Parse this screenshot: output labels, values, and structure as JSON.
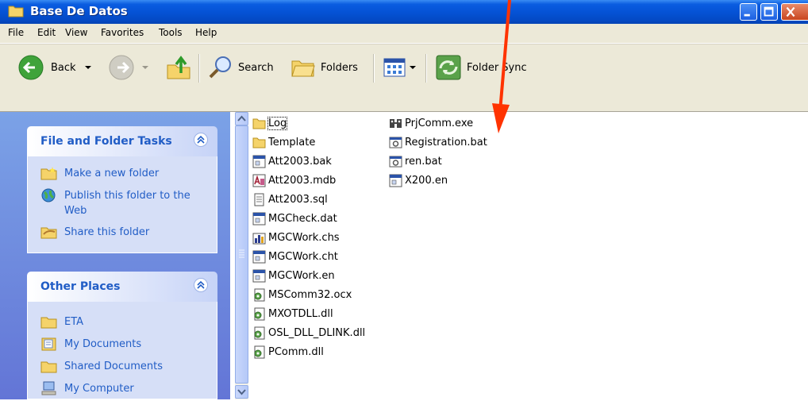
{
  "window": {
    "title": "Base De Datos"
  },
  "menu": {
    "items": [
      "File",
      "Edit",
      "View",
      "Favorites",
      "Tools",
      "Help"
    ]
  },
  "toolbar": {
    "back_label": "Back",
    "search_label": "Search",
    "folders_label": "Folders",
    "folder_sync_label": "Folder Sync"
  },
  "file_tasks": {
    "title": "File and Folder Tasks",
    "items": [
      "Make a new folder",
      "Publish this folder to the Web",
      "Share this folder"
    ]
  },
  "other_places": {
    "title": "Other Places",
    "items": [
      "ETA",
      "My Documents",
      "Shared Documents",
      "My Computer"
    ]
  },
  "files": {
    "column1": [
      "Log",
      "Template",
      "Att2003.bak",
      "Att2003.mdb",
      "Att2003.sql",
      "MGCheck.dat",
      "MGCWork.chs",
      "MGCWork.cht",
      "MGCWork.en",
      "MSComm32.ocx",
      "MXOTDLL.dll",
      "OSL_DLL_DLINK.dll",
      "PComm.dll"
    ],
    "column2": [
      "PrjComm.exe",
      "Registration.bat",
      "ren.bat",
      "X200.en"
    ]
  },
  "colors": {
    "titlebar": "#0553d6",
    "link": "#215dc6",
    "annotation_arrow": "#ff3300"
  }
}
